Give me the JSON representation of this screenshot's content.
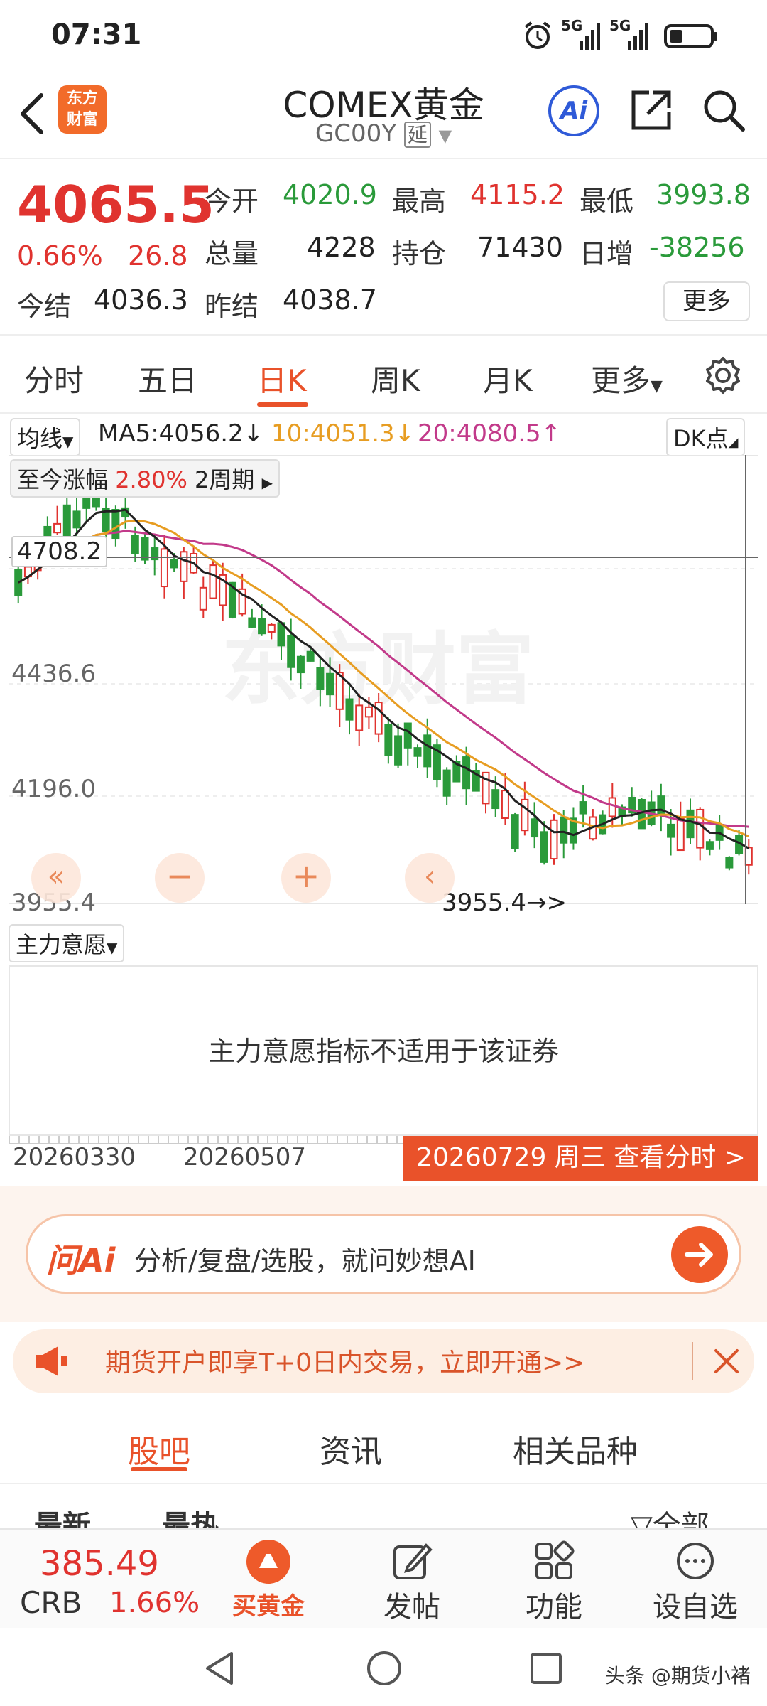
{
  "status": {
    "time": "07:31",
    "net1": "5G",
    "net2": "5G"
  },
  "header": {
    "logo_line1": "东方",
    "logo_line2": "财富",
    "title": "COMEX黄金",
    "subtitle": "GC00Y",
    "delay_badge": "延",
    "ai_label": "Ai"
  },
  "quote": {
    "price": "4065.5",
    "change_pct": "0.66%",
    "change": "26.8",
    "open_label": "今开",
    "open": "4020.9",
    "high_label": "最高",
    "high": "4115.2",
    "low_label": "最低",
    "low": "3993.8",
    "vol_label": "总量",
    "vol": "4228",
    "oi_label": "持仓",
    "oi": "71430",
    "daily_inc_label": "日增",
    "daily_inc": "-38256",
    "settle_label": "今结",
    "settle": "4036.3",
    "prev_settle_label": "昨结",
    "prev_settle": "4038.7",
    "more_label": "更多"
  },
  "tabs": [
    "分时",
    "五日",
    "日K",
    "周K",
    "月K",
    "更多"
  ],
  "chart": {
    "ma_selector": "均线",
    "ma5": "MA5:4056.2↓",
    "ma10": "10:4051.3↓",
    "ma20": "20:4080.5↑",
    "dk_label": "DK点",
    "rise_label": "至今涨幅",
    "rise_value": "2.80%",
    "rise_period": "2周期",
    "crosshair_price": "4708.2",
    "min_marker": "3955.4",
    "y_labels": [
      "4436.6",
      "4196.0",
      "3955.4"
    ],
    "indicator_selector": "主力意愿",
    "indicator_msg": "主力意愿指标不适用于该证券",
    "date_start": "20260330",
    "date_mid": "20260507",
    "date_popup": "20260729 周三 查看分时 >"
  },
  "ask_ai": {
    "brand": "问Ai",
    "placeholder": "分析/复盘/选股，就问妙想AI"
  },
  "banner": {
    "text": "期货开户即享T+0日内交易，立即开通>>"
  },
  "lower_tabs": [
    "股吧",
    "资讯",
    "相关品种"
  ],
  "feed_sort": {
    "latest": "最新",
    "hot": "最热",
    "filter": "全部"
  },
  "bottom_nav": {
    "crb_value": "385.49",
    "crb_label": "CRB",
    "crb_change": "1.66%",
    "buy_gold": "买黄金",
    "post": "发帖",
    "features": "功能",
    "watchlist": "设自选"
  },
  "watermark": "头条 @期货小褚",
  "colors": {
    "up": "#e0332f",
    "down": "#2a9a3a",
    "accent": "#e9522a"
  }
}
